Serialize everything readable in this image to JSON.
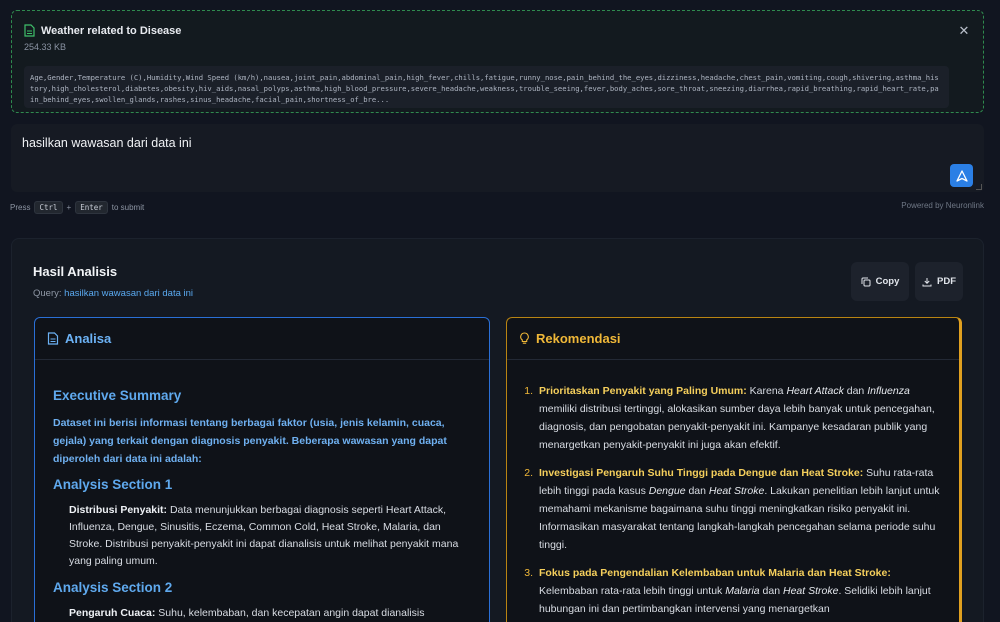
{
  "file": {
    "name": "Weather related to Disease",
    "size": "254.33 KB",
    "preview": "Age,Gender,Temperature (C),Humidity,Wind Speed (km/h),nausea,joint_pain,abdominal_pain,high_fever,chills,fatigue,runny_nose,pain_behind_the_eyes,dizziness,headache,chest_pain,vomiting,cough,shivering,asthma_history,high_cholesterol,diabetes,obesity,hiv_aids,nasal_polyps,asthma,high_blood_pressure,severe_headache,weakness,trouble_seeing,fever,body_aches,sore_throat,sneezing,diarrhea,rapid_breathing,rapid_heart_rate,pain_behind_eyes,swollen_glands,rashes,sinus_headache,facial_pain,shortness_of_bre..."
  },
  "prompt": {
    "text": "hasilkan wawasan dari data ini"
  },
  "hint": {
    "press": "Press",
    "key1": "Ctrl",
    "plus": "+",
    "key2": "Enter",
    "suffix": "to submit",
    "powered": "Powered by Neuronlink"
  },
  "results": {
    "title": "Hasil Analisis",
    "query_label": "Query:",
    "query_value": "hasilkan wawasan dari data ini",
    "copy_label": "Copy",
    "pdf_label": "PDF"
  },
  "analisa": {
    "header": "Analisa",
    "exec_title": "Executive Summary",
    "exec_text": "Dataset ini berisi informasi tentang berbagai faktor (usia, jenis kelamin, cuaca, gejala) yang terkait dengan diagnosis penyakit. Beberapa wawasan yang dapat diperoleh dari data ini adalah:",
    "section1_title": "Analysis Section 1",
    "section1_lead": "Distribusi Penyakit:",
    "section1_text": " Data menunjukkan berbagai diagnosis seperti Heart Attack, Influenza, Dengue, Sinusitis, Eczema, Common Cold, Heat Stroke, Malaria, dan Stroke. Distribusi penyakit-penyakit ini dapat dianalisis untuk melihat penyakit mana yang paling umum.",
    "section2_title": "Analysis Section 2",
    "section2_lead": "Pengaruh Cuaca:",
    "section2_text": " Suhu, kelembaban, dan kecepatan angin dapat dianalisis"
  },
  "rekomendasi": {
    "header": "Rekomendasi",
    "items": [
      {
        "num": "1.",
        "lead": "Prioritaskan Penyakit yang Paling Umum:",
        "t1": " Karena ",
        "i1": "Heart Attack",
        "t2": " dan ",
        "i2": "Influenza",
        "t3": " memiliki distribusi tertinggi, alokasikan sumber daya lebih banyak untuk pencegahan, diagnosis, dan pengobatan penyakit-penyakit ini. Kampanye kesadaran publik yang menargetkan penyakit-penyakit ini juga akan efektif."
      },
      {
        "num": "2.",
        "lead": "Investigasi Pengaruh Suhu Tinggi pada Dengue dan Heat Stroke:",
        "t1": " Suhu rata-rata lebih tinggi pada kasus ",
        "i1": "Dengue",
        "t2": " dan ",
        "i2": "Heat Stroke",
        "t3": ". Lakukan penelitian lebih lanjut untuk memahami mekanisme bagaimana suhu tinggi meningkatkan risiko penyakit ini. Informasikan masyarakat tentang langkah-langkah pencegahan selama periode suhu tinggi."
      },
      {
        "num": "3.",
        "lead": "Fokus pada Pengendalian Kelembaban untuk Malaria dan Heat Stroke:",
        "t1": " Kelembaban rata-rata lebih tinggi untuk ",
        "i1": "Malaria",
        "t2": " dan ",
        "i2": "Heat Stroke",
        "t3": ". Selidiki lebih lanjut hubungan ini dan pertimbangkan intervensi yang menargetkan"
      }
    ]
  },
  "colors": {
    "accent_blue": "#2b7fe5",
    "accent_amber": "#e0a020",
    "file_border": "#2f8a4f"
  },
  "icons": [
    "file-icon",
    "close-icon",
    "send-icon",
    "copy-icon",
    "download-icon",
    "document-icon",
    "lightbulb-icon"
  ]
}
